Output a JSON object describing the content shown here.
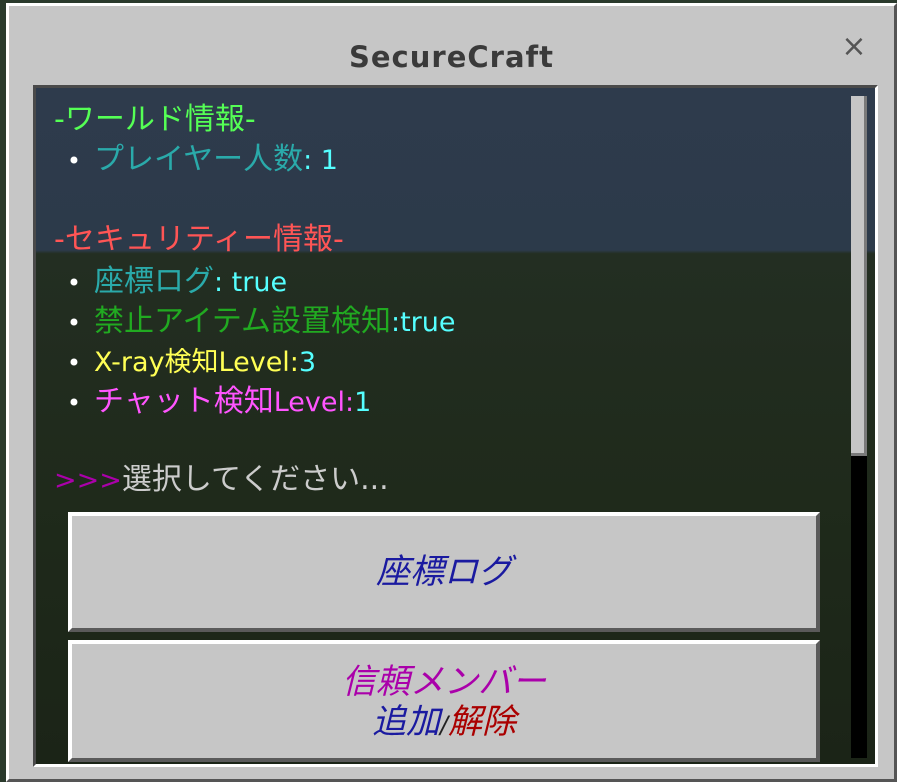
{
  "window": {
    "title": "SecureCraft",
    "close_icon": "×"
  },
  "colors": {
    "world_header": "#55ff55",
    "security_header": "#ff5555",
    "aqua": "#55ffff",
    "dark_aqua": "#2aaaaa",
    "dark_green": "#21aa21",
    "yellow": "#ffff55",
    "pink": "#ff55ff",
    "gray": "#cccccc",
    "purple_prompt": "#aa00aa",
    "btn_blue": "#1a1aa0",
    "btn_magenta": "#aa00aa",
    "btn_red": "#aa0000"
  },
  "info": {
    "world_header": "-ワールド情報-",
    "player_count_label": "プレイヤー人数",
    "player_count_value": ": 1",
    "security_header": "-セキュリティー情報-",
    "bullet": "•",
    "coord_log_label": "座標ログ",
    "coord_log_value": ": true",
    "banned_items_label": "禁止アイテム設置検知",
    "banned_items_value": ":true",
    "xray_label": "X-ray検知",
    "xray_level_label": "Level:",
    "xray_level_value": "3",
    "chat_label": "チャット検知",
    "chat_level_label": "Level:",
    "chat_level_value": "1",
    "prompt_arrows": ">>>",
    "prompt_text": "選択してください..."
  },
  "buttons": {
    "coord_log": "座標ログ",
    "trusted_line1": "信頼メンバー",
    "trusted_add": "追加",
    "trusted_slash": "/",
    "trusted_remove": "解除"
  }
}
